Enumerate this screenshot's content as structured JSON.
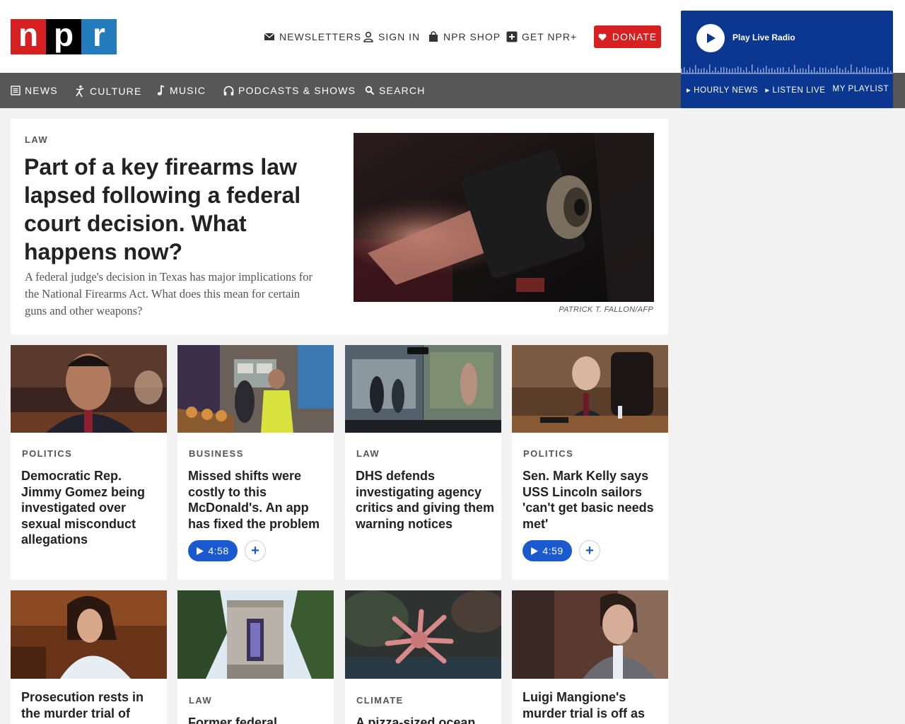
{
  "logo": {
    "letters": [
      "n",
      "p",
      "r"
    ]
  },
  "utility": {
    "newsletters": "NEWSLETTERS",
    "sign_in": "SIGN IN",
    "shop": "NPR SHOP",
    "plus": "GET NPR+",
    "donate": "DONATE"
  },
  "player": {
    "label": "Play Live Radio",
    "links": [
      "HOURLY NEWS",
      "LISTEN LIVE",
      "MY PLAYLIST"
    ]
  },
  "nav": {
    "items": [
      {
        "label": "NEWS",
        "icon": "newspaper-icon"
      },
      {
        "label": "CULTURE",
        "icon": "culture-icon"
      },
      {
        "label": "MUSIC",
        "icon": "music-note-icon"
      },
      {
        "label": "PODCASTS & SHOWS",
        "icon": "headphones-icon"
      },
      {
        "label": "SEARCH",
        "icon": "search-icon"
      }
    ]
  },
  "featured": {
    "slug": "LAW",
    "headline": "Part of a key firearms law lapsed following a federal court decision. What happens now?",
    "teaser": "A federal judge's decision in Texas has major implications for the National Firearms Act. What does this mean for certain guns and other weapons?",
    "credit": "PATRICK T. FALLON/AFP"
  },
  "cards_row1": [
    {
      "slug": "POLITICS",
      "headline": "Democratic Rep. Jimmy Gomez being investigated over sexual misconduct allegations",
      "duration": ""
    },
    {
      "slug": "BUSINESS",
      "headline": "Missed shifts were costly to this McDonald's. An app has fixed the problem",
      "duration": "4:58"
    },
    {
      "slug": "LAW",
      "headline": "DHS defends investigating agency critics and giving them warning notices",
      "duration": ""
    },
    {
      "slug": "POLITICS",
      "headline": "Sen. Mark Kelly says USS Lincoln sailors 'can't get basic needs met'",
      "duration": "4:59"
    }
  ],
  "cards_row2": [
    {
      "slug": "",
      "headline": "Prosecution rests in the murder trial of"
    },
    {
      "slug": "LAW",
      "headline": "Former federal"
    },
    {
      "slug": "CLIMATE",
      "headline": "A pizza-sized ocean"
    },
    {
      "slug": "",
      "headline": "Luigi Mangione's murder trial is off as"
    }
  ],
  "colors": {
    "npr_red": "#d62021",
    "npr_blue": "#237bbd",
    "player_blue": "#0b3791",
    "nav_gray": "#575757",
    "audio_blue": "#1a59ce"
  }
}
